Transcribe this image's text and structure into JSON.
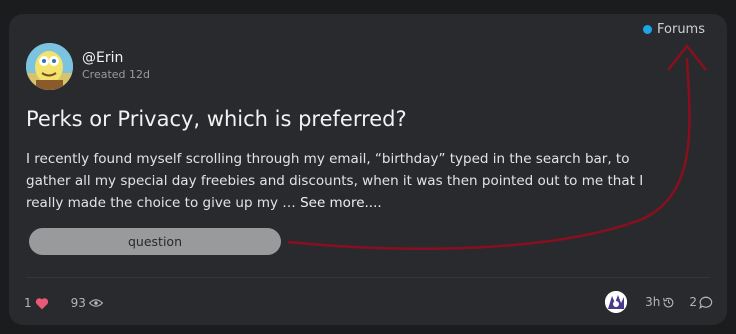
{
  "forums": {
    "label": "Forums",
    "dot_color": "#1da6e6"
  },
  "author": {
    "handle": "@Erin",
    "created": "Created 12d"
  },
  "post": {
    "title": "Perks or Privacy, which is preferred?",
    "body": "I recently found myself scrolling through my email, “birthday” typed in the search bar, to gather all my special day freebies and discounts, when it was then pointed out to me that I really made the choice to give up my …",
    "see_more": "See more...."
  },
  "tag": {
    "label": "question"
  },
  "stats": {
    "likes": "1",
    "views": "93",
    "time": "3h",
    "replies": "2"
  },
  "annotation": {
    "color": "#8a0f1e"
  },
  "icons": [
    "heart-icon",
    "eye-icon",
    "history-icon",
    "chat-bubble-icon"
  ]
}
